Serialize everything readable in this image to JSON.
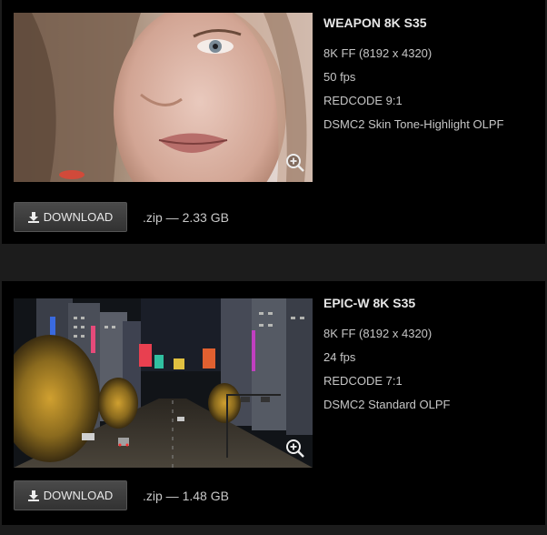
{
  "cameras": [
    {
      "title": "WEAPON 8K S35",
      "specs": [
        "8K FF (8192 x 4320)",
        "50 fps",
        "REDCODE 9:1",
        "DSMC2 Skin Tone-Highlight OLPF"
      ],
      "download_label": "DOWNLOAD",
      "file_info": ".zip — 2.33 GB",
      "thumbnail_icon": "zoom-in-icon"
    },
    {
      "title": "EPIC-W 8K S35",
      "specs": [
        "8K FF (8192 x 4320)",
        "24 fps",
        "REDCODE 7:1",
        "DSMC2 Standard OLPF"
      ],
      "download_label": "DOWNLOAD",
      "file_info": ".zip — 1.48 GB",
      "thumbnail_icon": "zoom-in-icon"
    }
  ],
  "colors": {
    "page_bg": "#1c1c1c",
    "card_bg": "#000000",
    "button_bg": "#3c3c3c"
  }
}
